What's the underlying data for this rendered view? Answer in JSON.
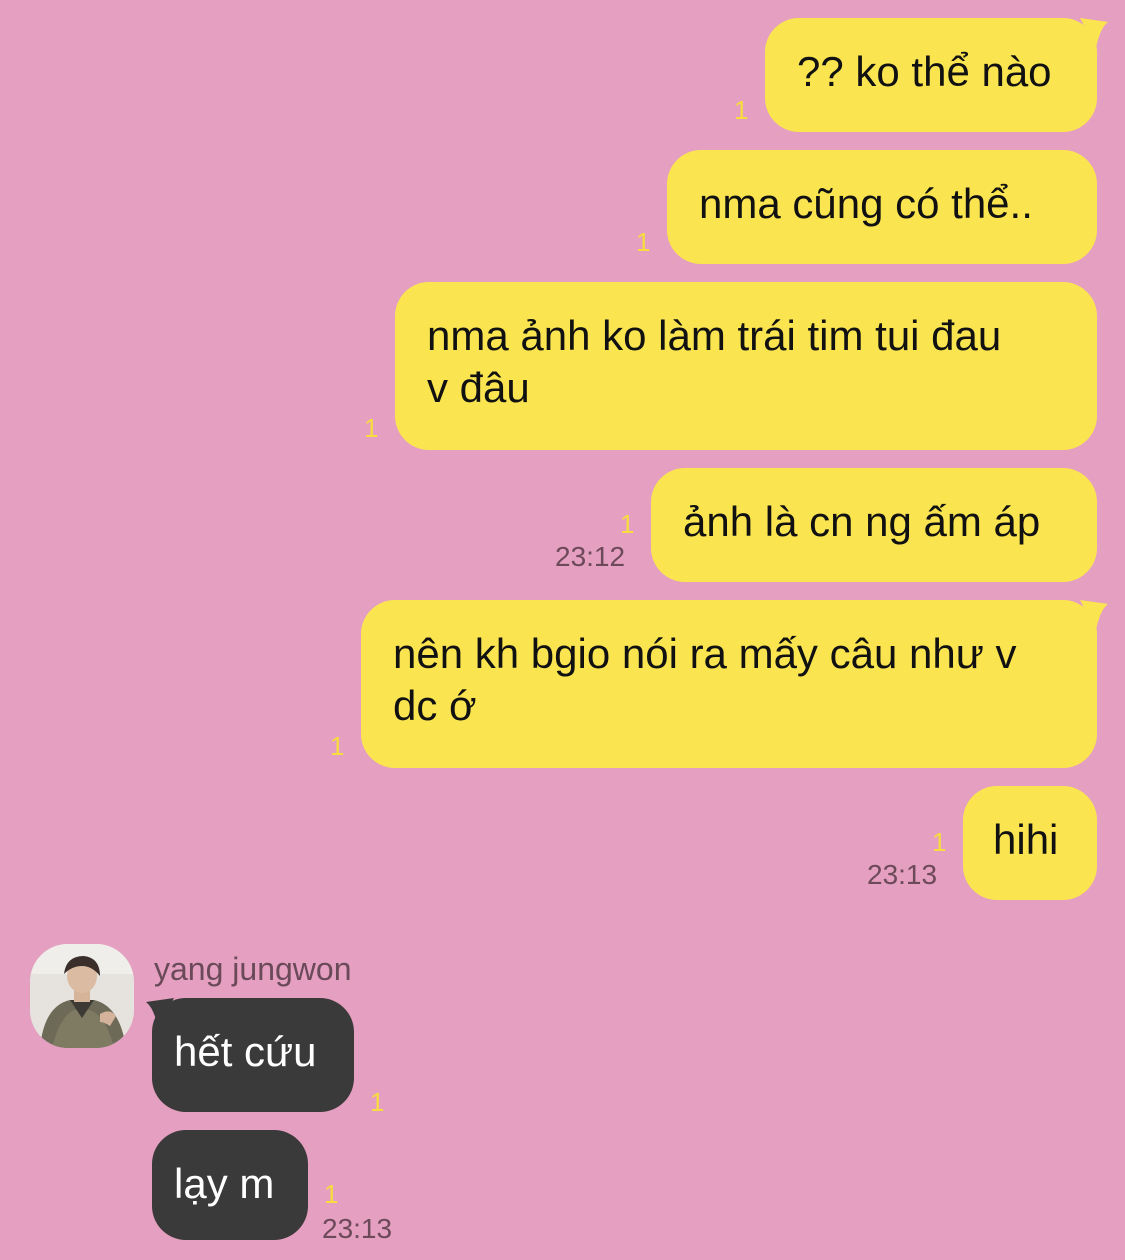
{
  "conversation": {
    "outgoing": [
      {
        "text": "?? ko thể nào",
        "unread": "1"
      },
      {
        "text": "nma cũng có thể..",
        "unread": "1"
      },
      {
        "text": "nma ảnh ko làm trái tim tui đau\nv đâu",
        "unread": "1"
      },
      {
        "text": "ảnh là cn ng ấm áp",
        "unread": "1",
        "time": "23:12"
      },
      {
        "text": "nên kh bgio nói ra mấy câu như v\ndc ớ",
        "unread": "1"
      },
      {
        "text": "hihi",
        "unread": "1",
        "time": "23:13"
      }
    ],
    "incoming": {
      "sender": "yang jungwon",
      "messages": [
        {
          "text": "hết cứu",
          "unread": "1"
        },
        {
          "text": "lạy m",
          "unread": "1",
          "time": "23:13"
        }
      ]
    }
  },
  "colors": {
    "background": "#e59fc0",
    "outgoing_bubble": "#fae550",
    "incoming_bubble": "#3a3a3a",
    "unread_count": "#f6dc3e",
    "timestamp": "#6d4a5a"
  }
}
